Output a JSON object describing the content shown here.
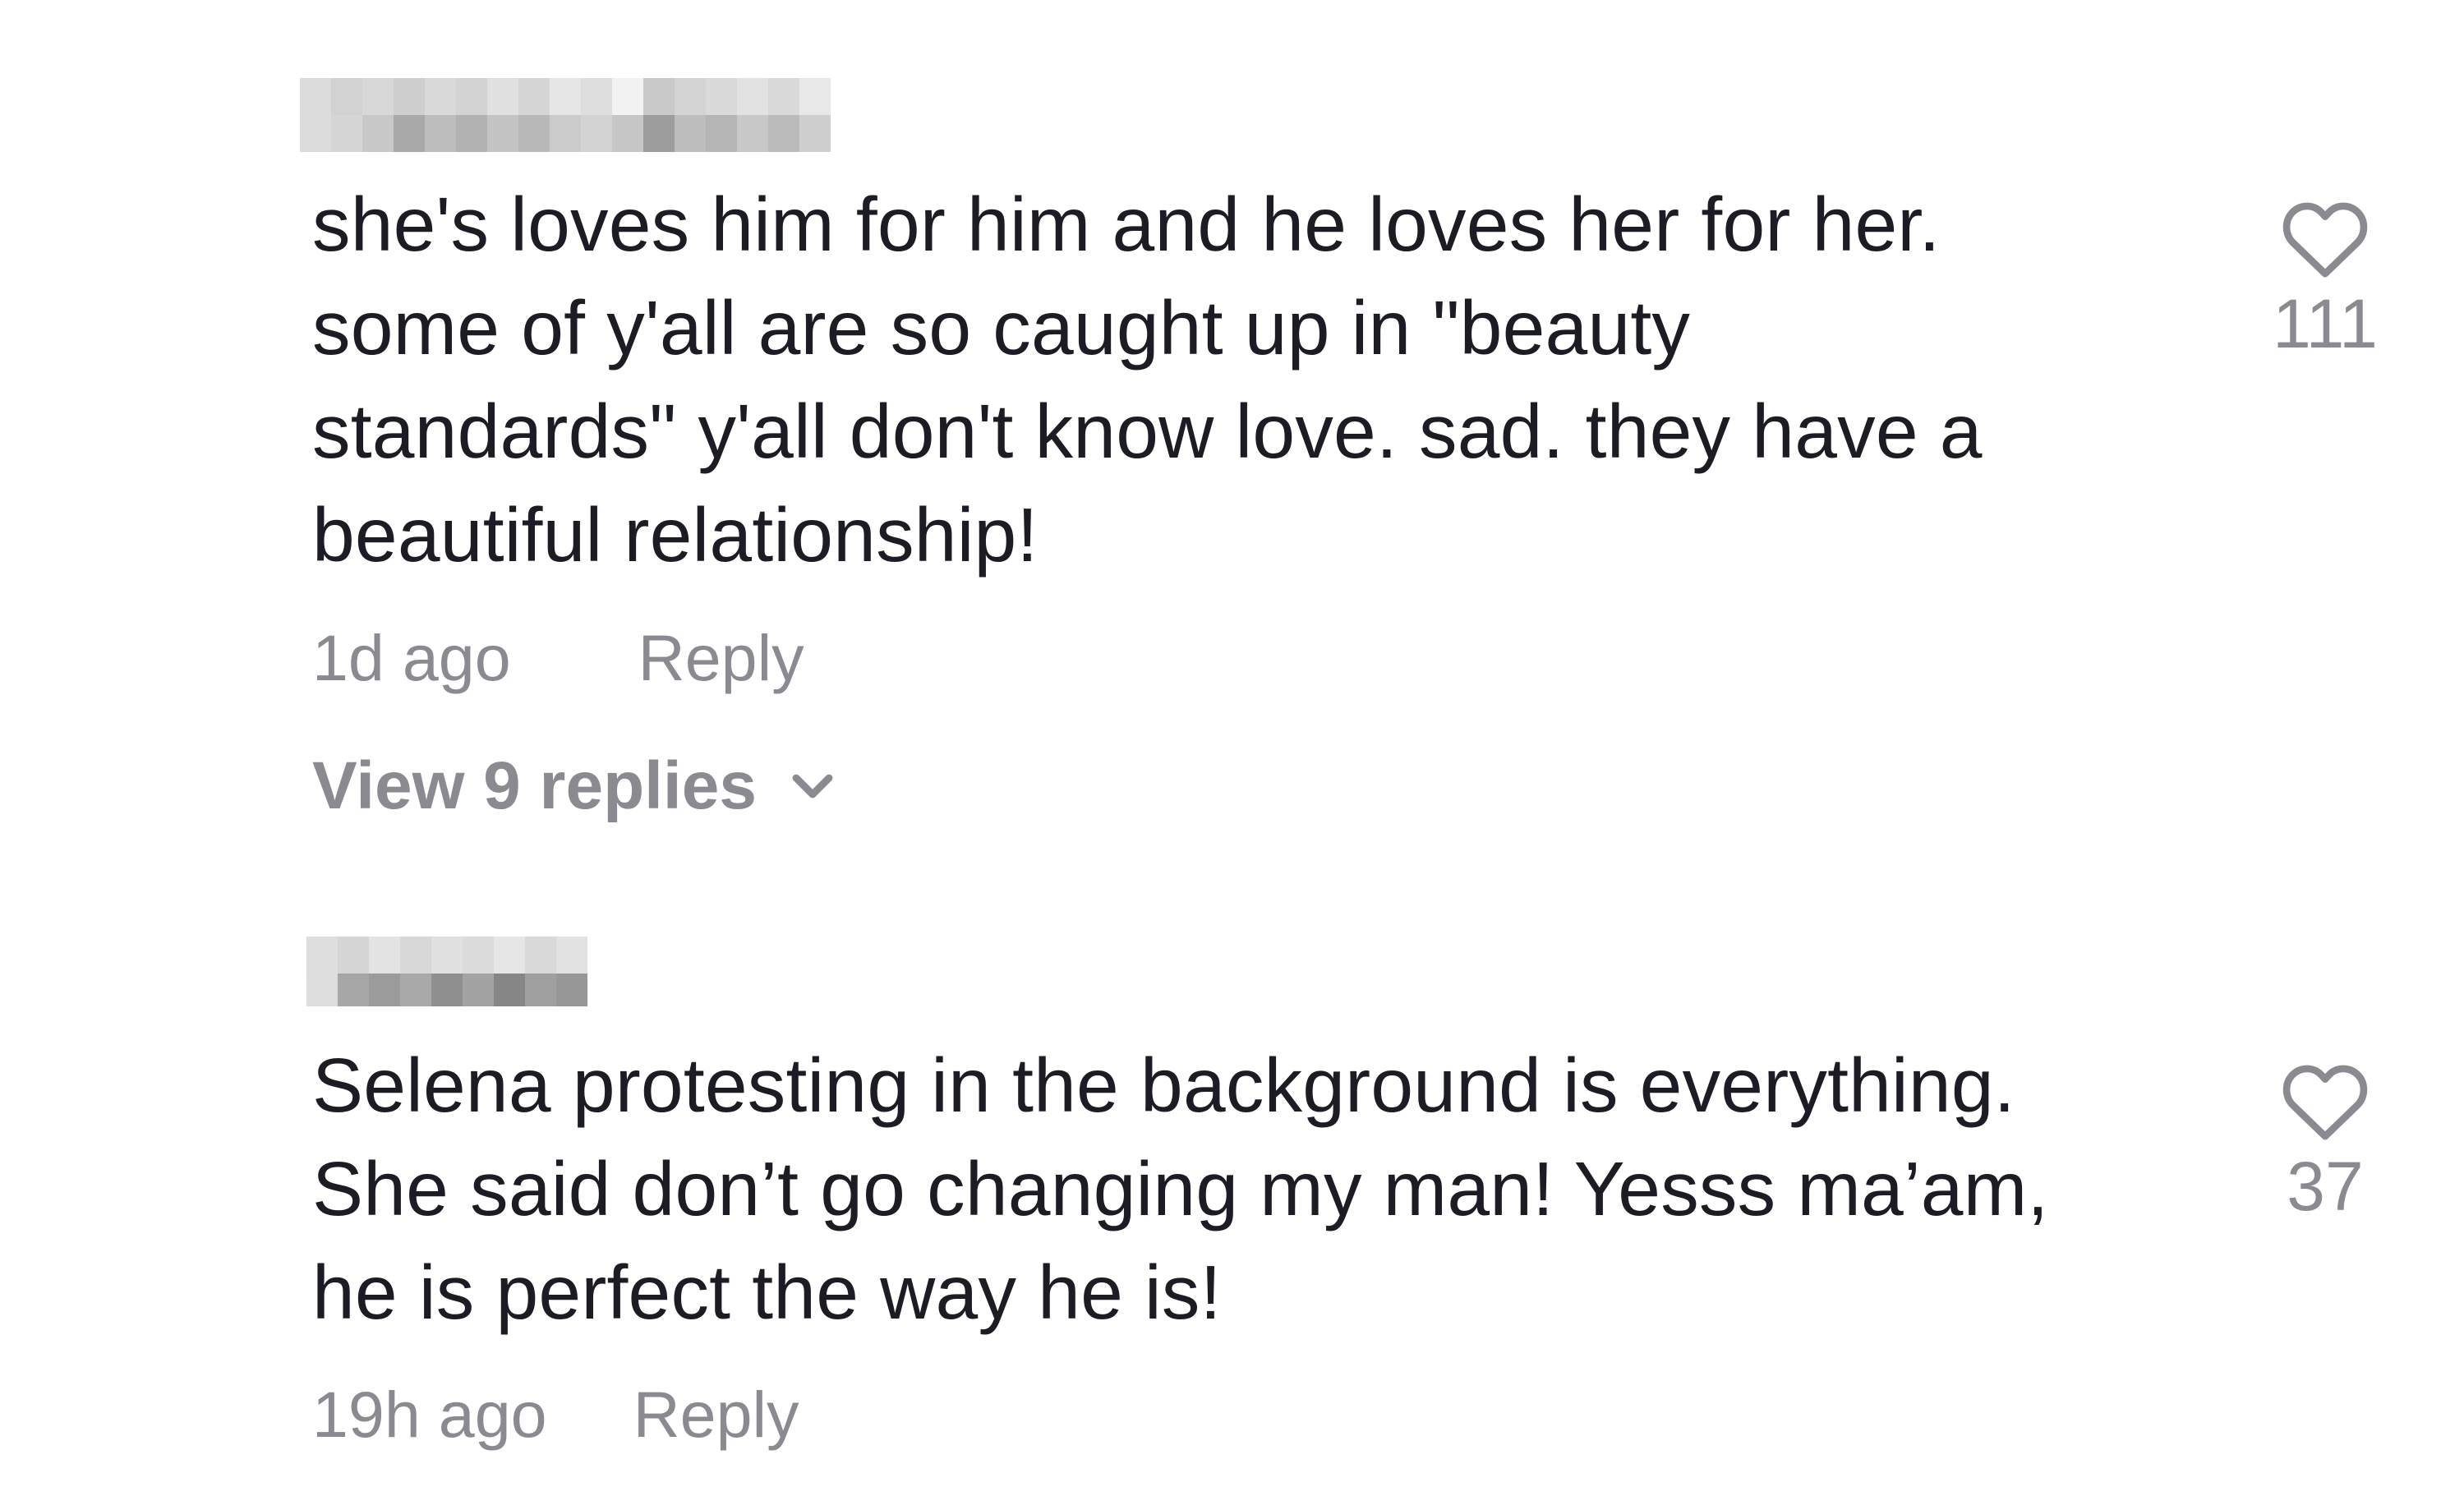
{
  "comments": [
    {
      "text": "she's loves him for him and he loves her for her.\nsome of y'all are so caught up in \"beauty\nstandards\" y'all don't know love. sad. they have a\nbeautiful relationship!",
      "time": "1d ago",
      "reply_label": "Reply",
      "likes": "111",
      "view_replies_label": "View 9 replies",
      "like_icon": "heart-outline-icon"
    },
    {
      "text": "Selena protesting in the background is everything.\nShe said don’t go changing my man! Yesss ma’am,\nhe is perfect the way he is!",
      "time": "19h ago",
      "reply_label": "Reply",
      "likes": "37",
      "like_icon": "heart-outline-icon"
    }
  ],
  "colors": {
    "text_primary": "#1c1c25",
    "text_secondary": "#8a8a90"
  }
}
